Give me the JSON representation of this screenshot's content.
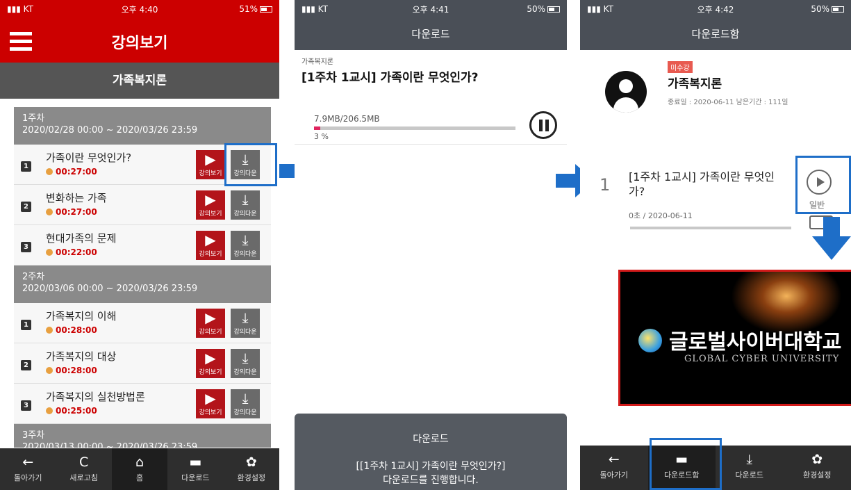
{
  "status": {
    "carrier": "KT",
    "s1": {
      "time": "오후 4:40",
      "battery": "51%"
    },
    "s2": {
      "time": "오후 4:41",
      "battery": "50%"
    },
    "s3": {
      "time": "오후 4:42",
      "battery": "50%"
    }
  },
  "screen1": {
    "title": "강의보기",
    "course": "가족복지론",
    "play_label": "강의보기",
    "download_label": "강의다운",
    "weeks": [
      {
        "label": "1주차",
        "period": "2020/02/28 00:00 ~ 2020/03/26 23:59",
        "lectures": [
          {
            "num": "1",
            "title": "가족이란 무엇인가?",
            "duration": "00:27:00"
          },
          {
            "num": "2",
            "title": "변화하는 가족",
            "duration": "00:27:00"
          },
          {
            "num": "3",
            "title": "현대가족의 문제",
            "duration": "00:22:00"
          }
        ]
      },
      {
        "label": "2주차",
        "period": "2020/03/06 00:00 ~ 2020/03/26 23:59",
        "lectures": [
          {
            "num": "1",
            "title": "가족복지의 이해",
            "duration": "00:28:00"
          },
          {
            "num": "2",
            "title": "가족복지의 대상",
            "duration": "00:28:00"
          },
          {
            "num": "3",
            "title": "가족복지의 실천방법론",
            "duration": "00:25:00"
          }
        ]
      },
      {
        "label": "3주차",
        "period": "2020/03/13 00:00 ~ 2020/03/26 23:59"
      }
    ],
    "nav": [
      {
        "icon": "back-arrow-icon",
        "glyph": "←",
        "label": "돌아가기"
      },
      {
        "icon": "refresh-icon",
        "glyph": "C",
        "label": "새로고침"
      },
      {
        "icon": "home-icon",
        "glyph": "⌂",
        "label": "홈"
      },
      {
        "icon": "folder-icon",
        "glyph": "▬",
        "label": "다운로드"
      },
      {
        "icon": "gear-icon",
        "glyph": "✿",
        "label": "환경설정"
      }
    ]
  },
  "screen2": {
    "title": "다운로드",
    "course": "가족복지론",
    "lecture": "[1주차 1교시] 가족이란 무엇인가?",
    "size": "7.9MB/206.5MB",
    "percent": "3 %",
    "progress": 3,
    "toast_title": "다운로드",
    "toast_line1": "[[1주차 1교시] 가족이란 무엇인가?]",
    "toast_line2": "다운로드를 진행합니다."
  },
  "screen3": {
    "title": "다운로드함",
    "badge": "미수강",
    "course": "가족복지론",
    "dates": "종료일 : 2020-06-11  남은기간 : 111일",
    "lecture_num": "1",
    "lecture_title": "[1주차 1교시] 가족이란 무엇인가?",
    "lecture_meta": "0초 / 2020-06-11",
    "mode": "일반",
    "video_title_kr": "글로벌사이버대학교",
    "video_title_en": "GLOBAL CYBER UNIVERSITY",
    "nav": [
      {
        "icon": "back-arrow-icon",
        "glyph": "←",
        "label": "돌아가기"
      },
      {
        "icon": "folder-icon",
        "glyph": "▬",
        "label": "다운로드함"
      },
      {
        "icon": "download-icon",
        "glyph": "⤓",
        "label": "다운로드"
      },
      {
        "icon": "gear-icon",
        "glyph": "✿",
        "label": "환경설정"
      }
    ]
  },
  "colors": {
    "brand_red": "#cc0000",
    "highlight_blue": "#1e6ec8",
    "dark_bar": "#4a4f57"
  }
}
